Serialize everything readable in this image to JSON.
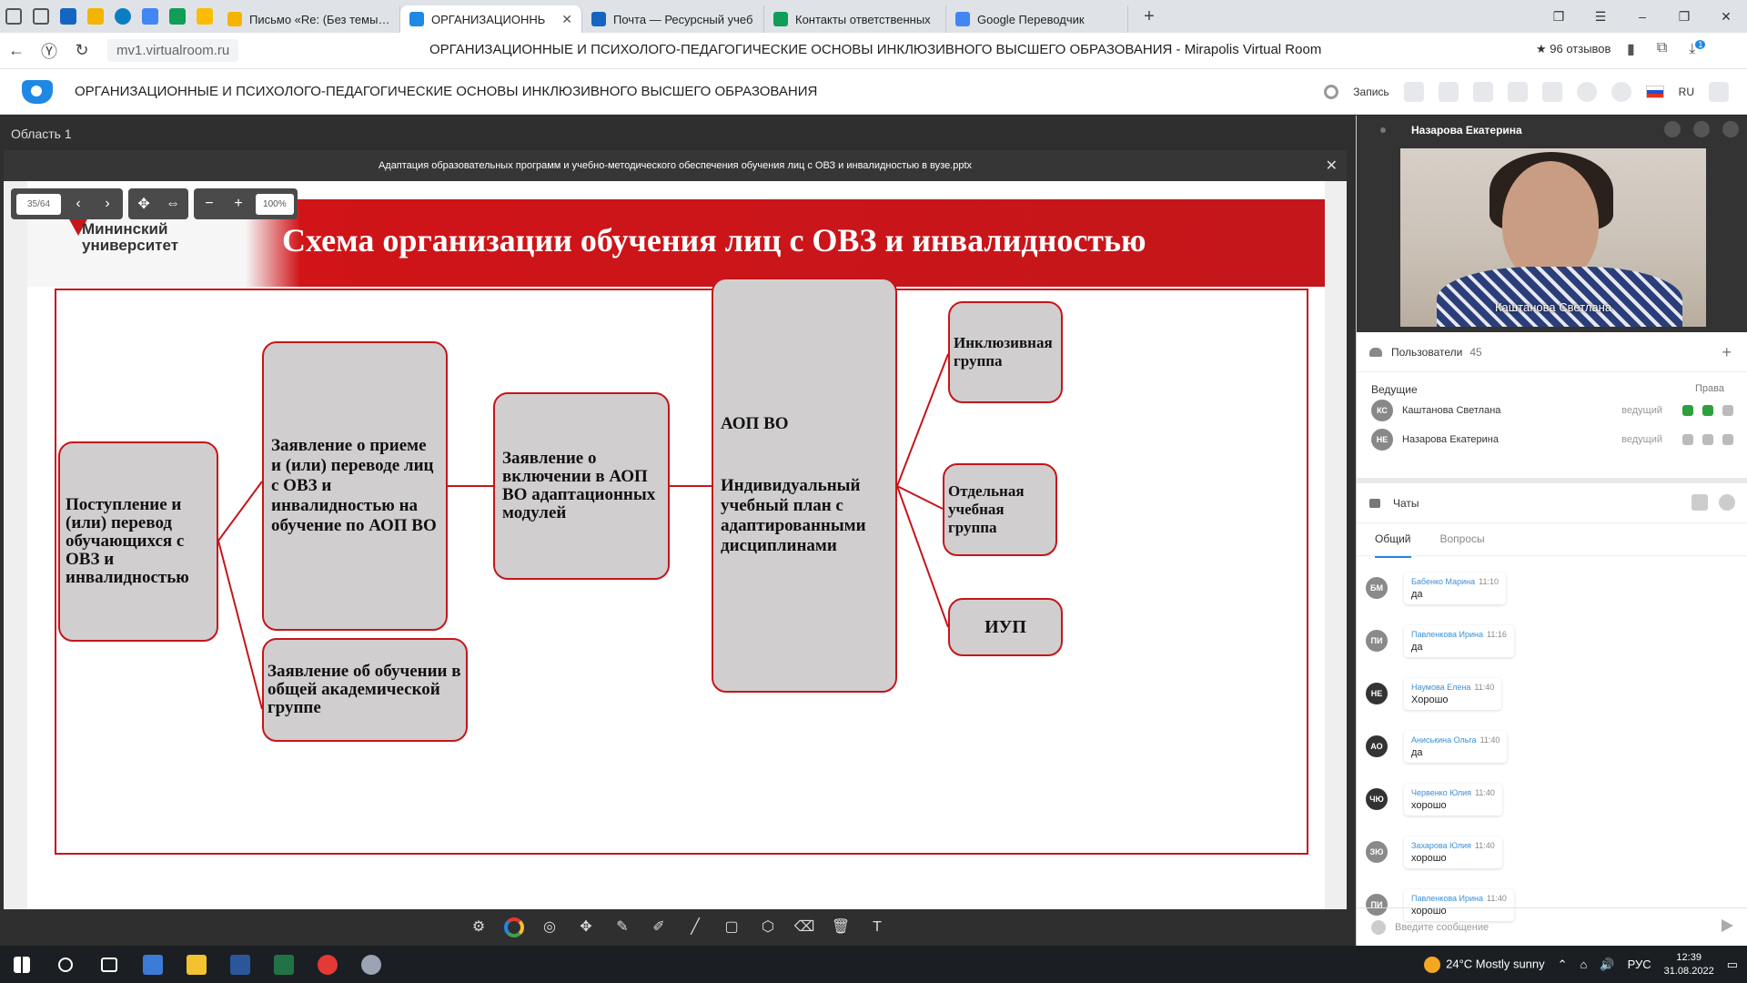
{
  "browser": {
    "tabs": [
      {
        "title": "Письмо «Re: (Без темы)» –",
        "color": "#f4b400",
        "active": false
      },
      {
        "title": "ОРГАНИЗАЦИОННЬ",
        "color": "#1e88e5",
        "active": true
      },
      {
        "title": "Почта — Ресурсный учеб",
        "color": "#1565c0",
        "active": false
      },
      {
        "title": "Контакты ответственных",
        "color": "#0f9d58",
        "active": false
      },
      {
        "title": "Google Переводчик",
        "color": "#4285f4",
        "active": false
      }
    ],
    "url": "mv1.virtualroom.ru",
    "page_title": "ОРГАНИЗАЦИОННЫЕ И ПСИХОЛОГО-ПЕДАГОГИЧЕСКИЕ ОСНОВЫ ИНКЛЮЗИВНОГО ВЫСШЕГО ОБРАЗОВАНИЯ - Mirapolis Virtual Room",
    "reviews": "★ 96 отзывов",
    "badge": "1"
  },
  "app": {
    "title": "ОРГАНИЗАЦИОННЫЕ И ПСИХОЛОГО-ПЕДАГОГИЧЕСКИЕ ОСНОВЫ ИНКЛЮЗИВНОГО ВЫСШЕГО ОБРАЗОВАНИЯ",
    "record_label": "Запись",
    "lang": "RU",
    "brand_color": "#1e88e5"
  },
  "workarea": {
    "label": "Область 1",
    "doc_title": "Адаптация образовательных программ и учебно-методического обеспечения обучения лиц с ОВЗ и инвалидностью в вузе.pptx",
    "page": "35/64",
    "zoom": "100%"
  },
  "slide": {
    "university_line1": "Мининский",
    "university_line2": "университет",
    "title": "Схема организации обучения лиц с ОВЗ и инвалидностью",
    "accent": "#c4161b",
    "box_fill": "#d0cece",
    "boxes": {
      "admission": "Поступление и (или) перевод обучающихся с ОВЗ и инвалидностью",
      "application": "Заявление о приеме и (или) переводе лиц с ОВЗ и инвалидностью на обучение по АОП ВО",
      "general": "Заявление об обучении в общей академической группе",
      "modules": "Заявление о включении в АОП ВО адаптационных модулей",
      "aop_title": "АОП ВО",
      "aop_text": "Индивидуальный учебный план с адаптированными дисциплинами",
      "inclusive": "Инклюзивная группа",
      "separate": "Отдельная учебная группа",
      "iup": "ИУП"
    }
  },
  "video": {
    "header_name": "Назарова Екатерина",
    "speaker_name": "Каштанова Светлана"
  },
  "users": {
    "title": "Пользователи",
    "count": "45",
    "section": "Ведущие",
    "rights": "Права",
    "list": [
      {
        "initials": "КС",
        "name": "Каштанова Светлана",
        "role": "ведущий"
      },
      {
        "initials": "НЕ",
        "name": "Назарова Екатерина",
        "role": "ведущий"
      }
    ]
  },
  "chats": {
    "title": "Чаты",
    "tab_general": "Общий",
    "tab_questions": "Вопросы",
    "input_placeholder": "Введите сообщение",
    "messages": [
      {
        "initials": "БМ",
        "name": "Бабенко Марина",
        "time": "11:10",
        "text": "да",
        "avatar": "#8a8a8a"
      },
      {
        "initials": "ПИ",
        "name": "Павленкова Ирина",
        "time": "11:16",
        "text": "да",
        "avatar": "#8a8a8a"
      },
      {
        "initials": "НЕ",
        "name": "Наумова Елена",
        "time": "11:40",
        "text": "Хорошо",
        "avatar": "#333333"
      },
      {
        "initials": "АО",
        "name": "Аниськина Ольга",
        "time": "11:40",
        "text": "да",
        "avatar": "#333333"
      },
      {
        "initials": "ЧЮ",
        "name": "Червенко Юлия",
        "time": "11:40",
        "text": "хорошо",
        "avatar": "#333333"
      },
      {
        "initials": "ЗЮ",
        "name": "Захарова Юлия",
        "time": "11:40",
        "text": "хорошо",
        "avatar": "#8a8a8a"
      },
      {
        "initials": "ПИ",
        "name": "Павленкова Ирина",
        "time": "11:40",
        "text": "хорошо",
        "avatar": "#8a8a8a"
      }
    ]
  },
  "taskbar": {
    "weather": "24°C  Mostly sunny",
    "lang": "РУС",
    "time": "12:39",
    "date": "31.08.2022"
  }
}
